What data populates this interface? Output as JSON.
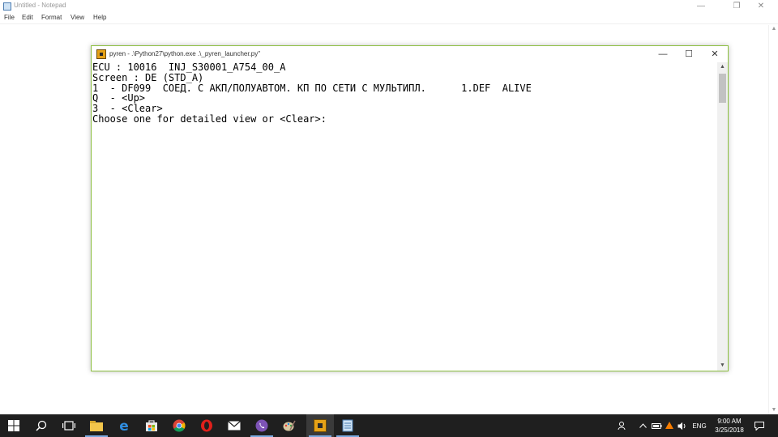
{
  "notepad": {
    "title": "Untitled - Notepad",
    "menu": [
      "File",
      "Edit",
      "Format",
      "View",
      "Help"
    ],
    "controls": {
      "minimize": "—",
      "maximize": "❐",
      "close": "✕"
    }
  },
  "console": {
    "title": "pyren - .\\Python27\\python.exe .\\_pyren_launcher.py\"",
    "controls": {
      "minimize": "—",
      "maximize": "☐",
      "close": "✕"
    },
    "lines": [
      "ECU : 10016  INJ_S30001_A754_00_A",
      "Screen : DE (STD_A)",
      "1  - DF099  СОЕД. С АКП/ПОЛУАВТОМ. КП ПО СЕТИ С МУЛЬТИПЛ.      1.DEF  ALIVE",
      "Q  - <Up>",
      "3  - <Clear>",
      "Choose one for detailed view or <Clear>:"
    ]
  },
  "taskbar": {
    "language": "ENG",
    "time": "9:00 AM",
    "date": "3/25/2018",
    "apps": [
      "start",
      "search",
      "task-view",
      "file-explorer",
      "edge",
      "store",
      "chrome",
      "opera",
      "mail",
      "viber",
      "paint",
      "pyren",
      "notepad"
    ],
    "active_app": "pyren"
  },
  "colors": {
    "console_border": "#8cbf3f",
    "taskbar_bg": "#1f1f1f",
    "active_underline": "#7aa9e0"
  }
}
